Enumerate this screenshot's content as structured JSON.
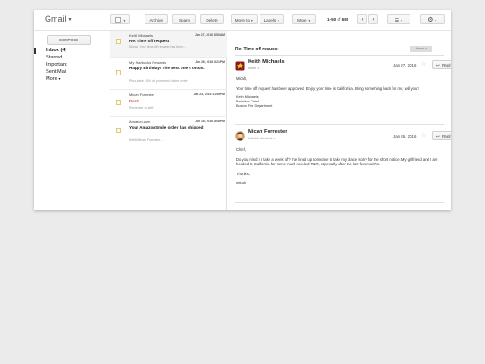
{
  "app": {
    "name": "Gmail"
  },
  "toolbar": {
    "archive": "Archive",
    "spam": "Spam",
    "delete": "Delete",
    "move_to": "Move to",
    "labels": "Labels",
    "more": "More",
    "pager_range": "1–50",
    "pager_of": "of",
    "pager_total": "680"
  },
  "sidebar": {
    "compose": "COMPOSE",
    "items": [
      {
        "label": "Inbox (4)"
      },
      {
        "label": "Starred"
      },
      {
        "label": "Important"
      },
      {
        "label": "Sent Mail"
      },
      {
        "label": "More"
      }
    ]
  },
  "list": [
    {
      "from": "Keith Michaels",
      "date": "Jan 27, 2016 8:50AM",
      "subject": "Re: Time off request",
      "snippet": "Micah, Your time off request has been..."
    },
    {
      "from": "My Starbucks Rewards",
      "date": "Jan 26, 2016 6:21PM",
      "subject": "Happy Birthday! The next one's on us.",
      "snippet": "Plus, take 15% off your next online order"
    },
    {
      "from": "Micah Forrester",
      "date": "Jan 23, 2016 11:59PM",
      "draft": "Draft",
      "snippet": "Reminder to self:"
    },
    {
      "from": "Amazon.com",
      "date": "Jan 16, 2016 8:08PM",
      "subject": "Your AmazonSmile order has shipped",
      "snippet": "Keith Micah Forrester, ..."
    }
  ],
  "thread": {
    "subject": "Re: Time off request",
    "label": "Inbox",
    "messages": [
      {
        "sender": "Keith Michaels",
        "to": "to me",
        "date": "Jan 27, 2016",
        "reply": "Reply",
        "body": [
          "Micah,",
          "Your time off request has been approved. Enjoy your time is California. Bring something back for me, will you?",
          "Keith Michaels",
          "Battalion Chief",
          "Boston Fire Department"
        ]
      },
      {
        "sender": "Micah Forrester",
        "to": "to Keith Michaels",
        "date": "Jan 26, 2016",
        "reply": "Reply",
        "body": [
          "Chief,",
          "Do you mind if I take a week off? I've lined up someone to take my place, sorry for the short notice. My girlfriend and I are headed to California for some much needed R&R, especially after the last few months.",
          "Thanks,",
          "Micah"
        ]
      }
    ]
  },
  "colors": {
    "draft": "#d14836",
    "badge": "#8b1a1a"
  }
}
